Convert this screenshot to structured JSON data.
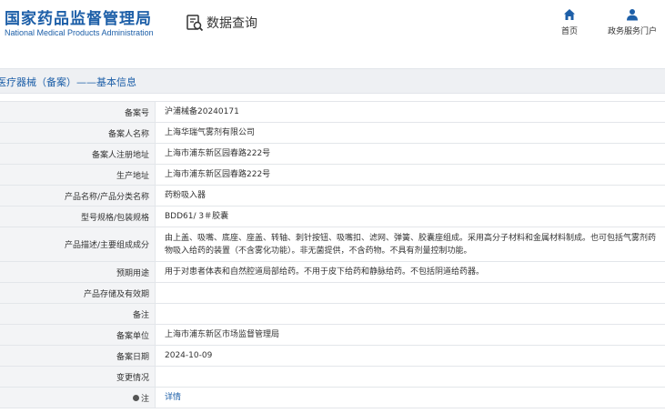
{
  "header": {
    "logo_cn": "国家药品监督管理局",
    "logo_en": "National Medical Products Administration",
    "query_label": "数据查询",
    "nav": [
      {
        "label": "首页",
        "icon": "home-icon"
      },
      {
        "label": "政务服务门户",
        "icon": "user-icon"
      }
    ]
  },
  "title": "医疗器械（备案）——基本信息",
  "rows": [
    {
      "label": "备案号",
      "value": "沪浦械备20240171"
    },
    {
      "label": "备案人名称",
      "value": "上海华瑞气雾剂有限公司"
    },
    {
      "label": "备案人注册地址",
      "value": "上海市浦东新区园春路222号"
    },
    {
      "label": "生产地址",
      "value": "上海市浦东新区园春路222号"
    },
    {
      "label": "产品名称/产品分类名称",
      "value": "药粉吸入器"
    },
    {
      "label": "型号规格/包装规格",
      "value": "BDD61/ 3＃胶囊"
    },
    {
      "label": "产品描述/主要组成成分",
      "value": "由上盖、吸嘴、底座、座盖、转轴、刺针按钮、吸嘴扣、滤网、弹簧、胶囊座组成。采用高分子材料和金属材料制成。也可包括气雾剂药物吸入给药的装置（不含雾化功能）。非无菌提供，不含药物。不具有剂量控制功能。"
    },
    {
      "label": "预期用途",
      "value": "用于对患者体表和自然腔道局部给药。不用于皮下给药和静脉给药。不包括阴道给药器。"
    },
    {
      "label": "产品存储及有效期",
      "value": ""
    },
    {
      "label": "备注",
      "value": ""
    },
    {
      "label": "备案单位",
      "value": "上海市浦东新区市场监督管理局"
    },
    {
      "label": "备案日期",
      "value": "2024-10-09"
    },
    {
      "label": "变更情况",
      "value": ""
    },
    {
      "label": "注",
      "value": "详情",
      "icon": "tip-icon"
    }
  ],
  "colors": {
    "brand": "#1d5fa8",
    "label_bg": "#f3f4f6",
    "border": "#e3e6ea"
  }
}
